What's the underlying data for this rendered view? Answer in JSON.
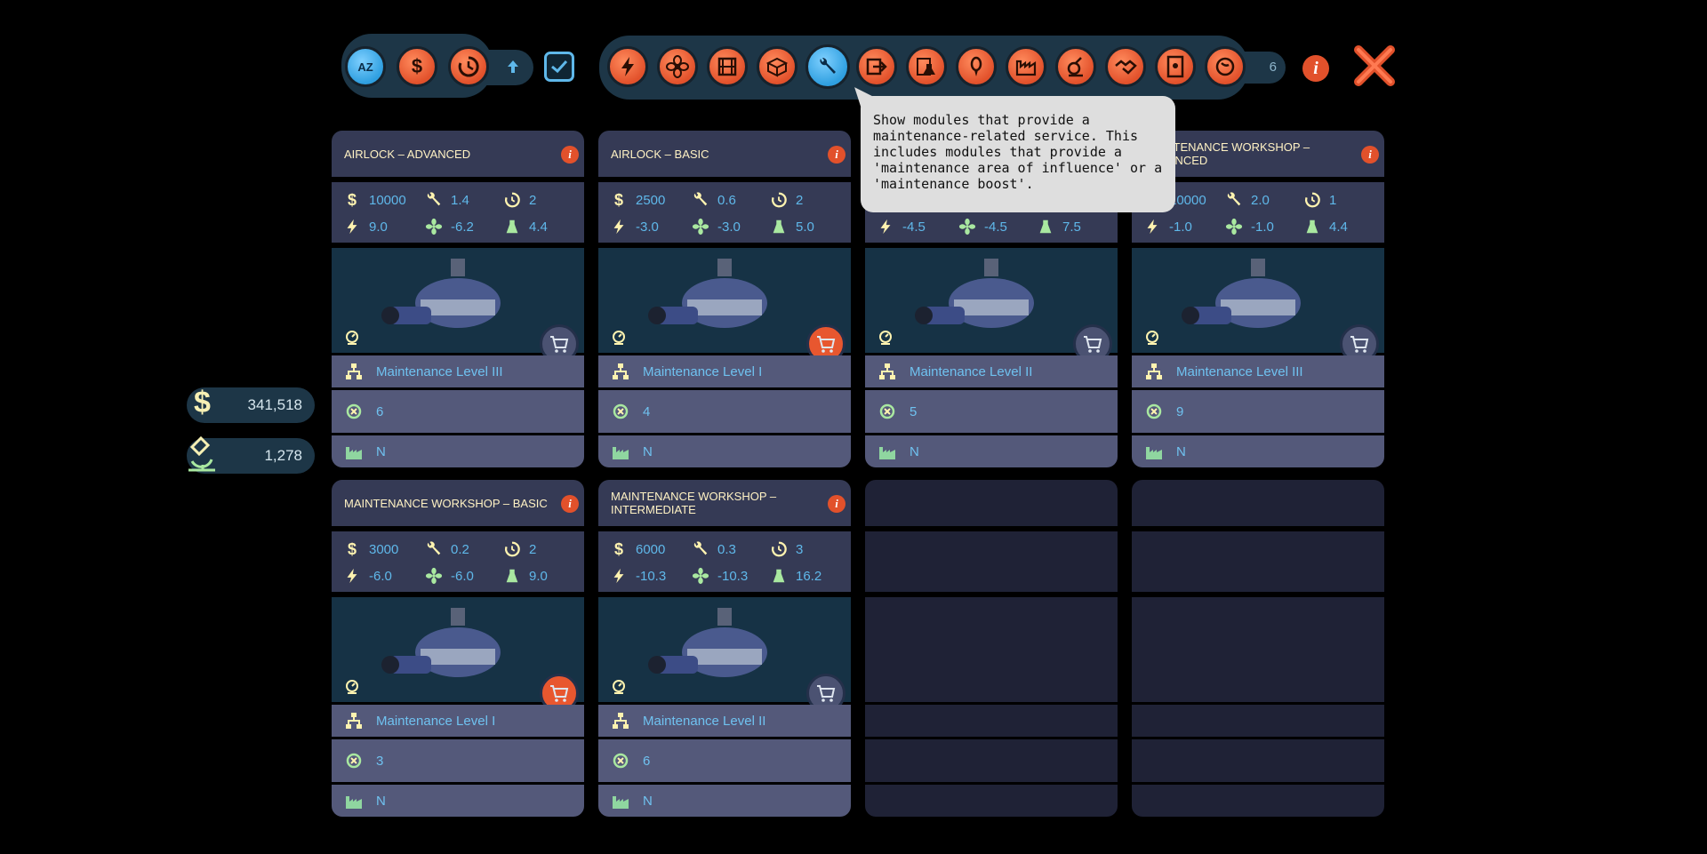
{
  "toolbar": {
    "sort_buttons": [
      {
        "name": "sort-az-icon",
        "label": "AZ",
        "active": true
      },
      {
        "name": "sort-cost-icon",
        "label": "$",
        "active": false
      },
      {
        "name": "sort-time-icon",
        "label": "",
        "active": false
      }
    ],
    "sort_direction_icon": "arrow-up-icon",
    "checkbox_checked": true,
    "filters": [
      {
        "name": "filter-power-icon",
        "active": false
      },
      {
        "name": "filter-air-icon",
        "active": false
      },
      {
        "name": "filter-storage-icon",
        "active": false
      },
      {
        "name": "filter-crate-icon",
        "active": false
      },
      {
        "name": "filter-maintenance-icon",
        "active": true
      },
      {
        "name": "filter-docking-icon",
        "active": false
      },
      {
        "name": "filter-science-icon",
        "active": false
      },
      {
        "name": "filter-crew-icon",
        "active": false
      },
      {
        "name": "filter-industry-icon",
        "active": false
      },
      {
        "name": "filter-medical-icon",
        "active": false
      },
      {
        "name": "filter-trade-icon",
        "active": false
      },
      {
        "name": "filter-document-icon",
        "active": false
      },
      {
        "name": "filter-food-icon",
        "active": false
      }
    ],
    "result_count": "6",
    "info_label": "i",
    "close_label": "✕"
  },
  "tooltip": {
    "text": "Show modules that provide a\nmaintenance-related service. This\nincludes modules that provide a\n'maintenance area of influence' or a\n'maintenance boost'."
  },
  "resources": {
    "money": "341,518",
    "science": "1,278"
  },
  "colors": {
    "accent_orange": "#e2512b",
    "accent_blue": "#2f9fe0",
    "value_blue": "#5fb8ea",
    "card_bg": "#353a55",
    "row_bg": "#54597a"
  },
  "cards": [
    {
      "title": "AIRLOCK – ADVANCED",
      "cost": "10000",
      "maint": "1.4",
      "time": "2",
      "power": "9.0",
      "air": "-6.2",
      "mass": "4.4",
      "level": "Maintenance Level III",
      "count": "6",
      "flag": "N",
      "cart_active": false
    },
    {
      "title": "AIRLOCK – BASIC",
      "cost": "2500",
      "maint": "0.6",
      "time": "2",
      "power": "-3.0",
      "air": "-3.0",
      "mass": "5.0",
      "level": "Maintenance Level I",
      "count": "4",
      "flag": "N",
      "cart_active": true
    },
    {
      "title": "",
      "cost": "",
      "maint": "",
      "time": "",
      "power": "-4.5",
      "air": "-4.5",
      "mass": "7.5",
      "level": "Maintenance Level II",
      "count": "5",
      "flag": "N",
      "cart_active": false
    },
    {
      "title": "MAINTENANCE WORKSHOP – ADVANCED",
      "cost": "10000",
      "maint": "2.0",
      "time": "1",
      "power": "-1.0",
      "air": "-1.0",
      "mass": "4.4",
      "level": "Maintenance Level III",
      "count": "9",
      "flag": "N",
      "cart_active": false
    },
    {
      "title": "MAINTENANCE WORKSHOP – BASIC",
      "cost": "3000",
      "maint": "0.2",
      "time": "2",
      "power": "-6.0",
      "air": "-6.0",
      "mass": "9.0",
      "level": "Maintenance Level I",
      "count": "3",
      "flag": "N",
      "cart_active": true
    },
    {
      "title": "MAINTENANCE WORKSHOP – INTERMEDIATE",
      "cost": "6000",
      "maint": "0.3",
      "time": "3",
      "power": "-10.3",
      "air": "-10.3",
      "mass": "16.2",
      "level": "Maintenance Level II",
      "count": "6",
      "flag": "N",
      "cart_active": false
    }
  ]
}
